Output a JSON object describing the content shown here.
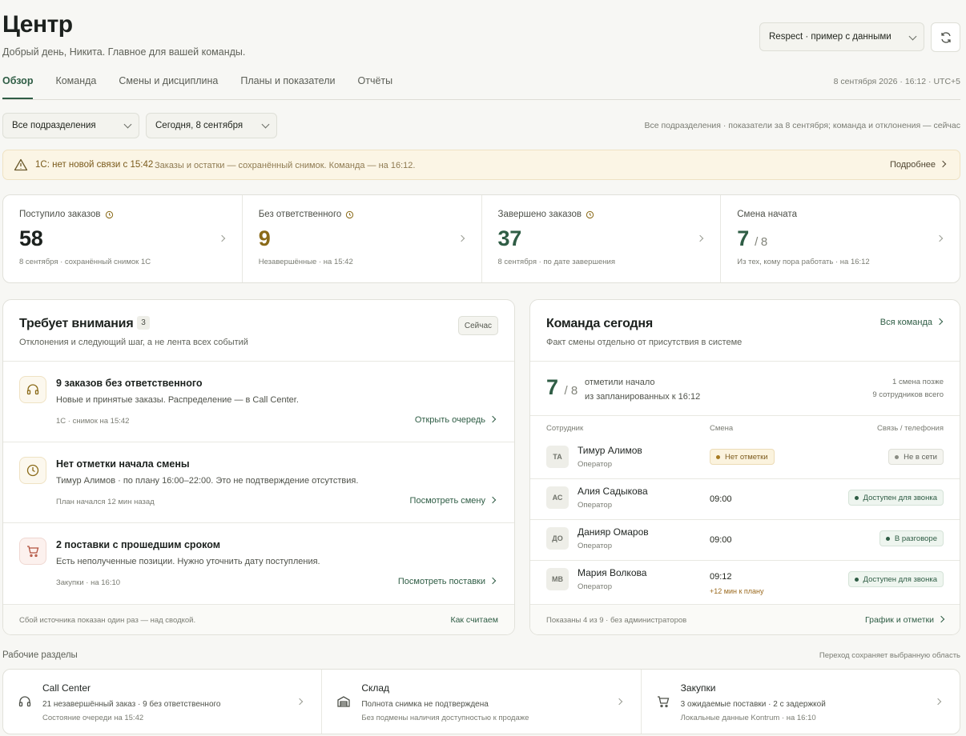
{
  "header": {
    "title": "Центр",
    "subtitle": "Добрый день, Никита. Главное для вашей команды.",
    "area_select": "Respect · пример с данными",
    "datetime": "8 сентября 2026 · 16:12 · UTC+5"
  },
  "tabs": [
    "Обзор",
    "Команда",
    "Смены и дисциплина",
    "Планы и показатели",
    "Отчёты"
  ],
  "filters": {
    "department": "Все подразделения",
    "date": "Сегодня, 8 сентября",
    "note": "Все подразделения · показатели за 8 сентября; команда и отклонения — сейчас"
  },
  "alert": {
    "title": "1С: нет новой связи с 15:42",
    "text": "Заказы и остатки — сохранённый снимок. Команда — на 16:12.",
    "link": "Подробнее",
    "accent": "#fbf5e5"
  },
  "kpis": [
    {
      "label": "Поступило заказов",
      "value": "58",
      "of": "",
      "note": "8 сентября · сохранённый снимок 1С",
      "color": "#1c211e",
      "clock": true
    },
    {
      "label": "Без ответственного",
      "value": "9",
      "of": "",
      "note": "Незавершённые · на 15:42",
      "color": "#8a6a18",
      "clock": true
    },
    {
      "label": "Завершено заказов",
      "value": "37",
      "of": "",
      "note": "8 сентября · по дате завершения",
      "color": "#2f5d45",
      "clock": true
    },
    {
      "label": "Смена начата",
      "value": "7",
      "of": "/ 8",
      "note": "Из тех, кому пора работать · на 16:12",
      "color": "#2f5d45",
      "clock": false
    }
  ],
  "attention": {
    "title": "Требует внимания",
    "count": "3",
    "subtitle": "Отклонения и следующий шаг, а не лента всех событий",
    "now_btn": "Сейчас",
    "items": [
      {
        "title": "9 заказов без ответственного",
        "text": "Новые и принятые заказы. Распределение — в Call Center.",
        "meta": "1С · снимок на 15:42",
        "link": "Открыть очередь",
        "icon": "headset-icon"
      },
      {
        "title": "Нет отметки начала смены",
        "text": "Тимур Алимов · по плану 16:00–22:00. Это не подтверждение отсутствия.",
        "meta": "План начался 12 мин назад",
        "link": "Посмотреть смену",
        "icon": "clock-icon"
      },
      {
        "title": "2 поставки с прошедшим сроком",
        "text": "Есть неполученные позиции. Нужно уточнить дату поступления.",
        "meta": "Закупки · на 16:10",
        "link": "Посмотреть поставки",
        "icon": "cart-icon"
      }
    ],
    "foot_note": "Сбой источника показан один раз — над сводкой.",
    "foot_link": "Как считаем"
  },
  "team": {
    "title": "Команда сегодня",
    "subtitle": "Факт смены отдельно от присутствия в системе",
    "link": "Вся команда",
    "started": "7",
    "planned": "/ 8",
    "line1": "отметили начало",
    "line2": "из запланированных к 16:12",
    "right1": "1 смена позже",
    "right2": "9 сотрудников всего",
    "headers": {
      "employee": "Сотрудник",
      "shift": "Смена",
      "contact": "Связь / телефония"
    },
    "rows": [
      {
        "initials": "ТА",
        "name": "Тимур Алимов",
        "role": "Оператор",
        "shift": "",
        "shift_badge": "Нет отметки",
        "late": "",
        "status": "Не в сети",
        "status_kind": "gray"
      },
      {
        "initials": "АС",
        "name": "Алия Садыкова",
        "role": "Оператор",
        "shift": "09:00",
        "shift_badge": "",
        "late": "",
        "status": "Доступен для звонка",
        "status_kind": "ok"
      },
      {
        "initials": "ДО",
        "name": "Данияр Омаров",
        "role": "Оператор",
        "shift": "09:00",
        "shift_badge": "",
        "late": "",
        "status": "В разговоре",
        "status_kind": "ok"
      },
      {
        "initials": "МВ",
        "name": "Мария Волкова",
        "role": "Оператор",
        "shift": "09:12",
        "shift_badge": "",
        "late": "+12 мин к плану",
        "status": "Доступен для звонка",
        "status_kind": "ok"
      }
    ],
    "foot_note": "Показаны 4 из 9 · без администраторов",
    "foot_link": "График и отметки"
  },
  "sections": {
    "title": "Рабочие разделы",
    "note": "Переход сохраняет выбранную область",
    "items": [
      {
        "name": "Call Center",
        "line1": "21 незавершённый заказ · 9 без ответственного",
        "line2": "Состояние очереди на 15:42",
        "icon": "headset-icon"
      },
      {
        "name": "Склад",
        "line1": "Полнота снимка не подтверждена",
        "line2": "Без подмены наличия доступностью к продаже",
        "icon": "warehouse-icon"
      },
      {
        "name": "Закупки",
        "line1": "3 ожидаемые поставки · 2 с задержкой",
        "line2": "Локальные данные Kontrum · на 16:10",
        "icon": "cart-icon"
      }
    ]
  }
}
